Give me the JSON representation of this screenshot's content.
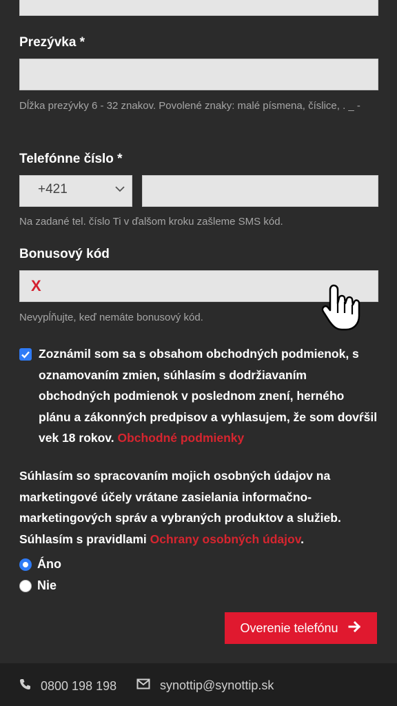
{
  "form": {
    "nickname": {
      "label": "Prezývka *",
      "value": "",
      "hint": "Dĺžka prezývky 6 - 32 znakov. Povolené znaky: malé písmena, číslice, . _ -"
    },
    "phone": {
      "label": "Telefónne číslo *",
      "prefix": "+421",
      "value": "",
      "hint": "Na zadané tel. číslo Ti v ďalšom kroku zašleme SMS kód."
    },
    "bonus": {
      "label": "Bonusový kód",
      "clear_glyph": "X",
      "value": "",
      "hint": "Nevypĺňujte, keď nemáte bonusový kód."
    },
    "terms": {
      "checked": true,
      "text": "Zoznámil som sa s obsahom obchodných podmienok, s oznamovaním zmien, súhlasím s dodržiavaním obchodných podmienok v poslednom znení, herného plánu a zákonných predpisov a vyhlasujem, že som dovŕšil vek 18 rokov.",
      "link": "Obchodné podmienky"
    },
    "marketing": {
      "text": "Súhlasím so spracovaním mojich osobných údajov na marketingové účely vrátane zasielania informačno-marketingových správ a vybraných produktov a služieb. Súhlasím s pravidlami",
      "link": "Ochrany osobných údajov",
      "suffix": ".",
      "options": [
        {
          "label": "Áno",
          "selected": true
        },
        {
          "label": "Nie",
          "selected": false
        }
      ]
    },
    "submit_label": "Overenie telefónu"
  },
  "footer": {
    "phone": "0800 198 198",
    "email": "synottip@synottip.sk"
  },
  "colors": {
    "accent": "#e0192f",
    "link": "#d6252f",
    "checkbox": "#2f7bf6"
  },
  "icons": [
    "chevron-down-icon",
    "hand-pointer-icon",
    "arrow-right-icon",
    "phone-icon",
    "envelope-icon"
  ]
}
